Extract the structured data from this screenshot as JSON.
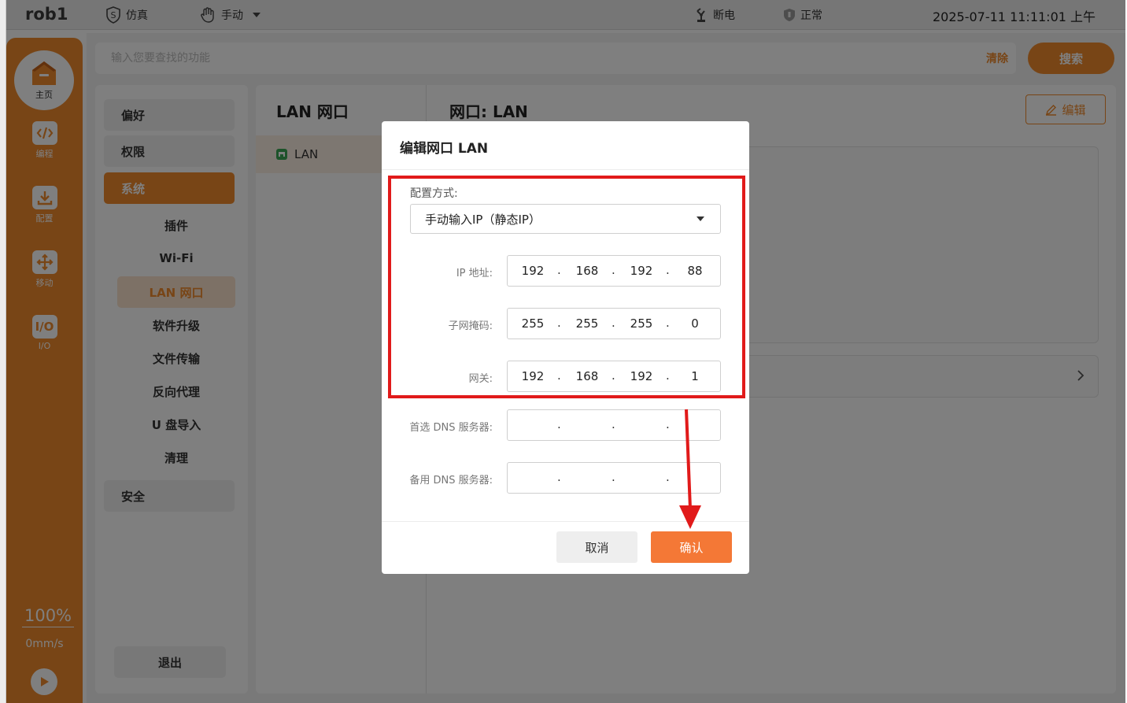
{
  "topbar": {
    "title": "rob1",
    "sim_label": "仿真",
    "manual_label": "手动",
    "power_label": "断电",
    "status_label": "正常",
    "datetime": "2025-07-11 11:11:01 上午"
  },
  "sidebar": {
    "home_label": "主页",
    "items": [
      {
        "label": "编程",
        "icon": "code-icon"
      },
      {
        "label": "配置",
        "icon": "download-icon"
      },
      {
        "label": "移动",
        "icon": "move-icon"
      },
      {
        "label": "I/O",
        "icon": "io-icon",
        "icon_text": "I/O"
      }
    ],
    "speed_percent": "100%",
    "speed_value": "0mm/s",
    "bottom_text": [
      "?",
      "?",
      "?",
      "?"
    ]
  },
  "search": {
    "placeholder": "输入您要查找的功能",
    "clear_label": "清除",
    "search_label": "搜索"
  },
  "settings_nav": {
    "categories": [
      "偏好",
      "权限",
      "系统",
      "安全"
    ],
    "active_category": "系统",
    "sub_items": [
      "插件",
      "Wi-Fi",
      "LAN 网口",
      "软件升级",
      "文件传输",
      "反向代理",
      "U 盘导入",
      "清理"
    ],
    "active_sub_item": "LAN 网口",
    "logout_label": "退出"
  },
  "iface_panel": {
    "title": "LAN 网口",
    "item_label": "LAN"
  },
  "detail_panel": {
    "title": "网口:  LAN",
    "edit_label": "编辑"
  },
  "modal": {
    "title": "编辑网口 LAN",
    "mode_label": "配置方式:",
    "mode_value": "手动输入IP（静态IP）",
    "fields": [
      {
        "label": "IP 地址:",
        "octets": [
          "192",
          "168",
          "192",
          "88"
        ]
      },
      {
        "label": "子网掩码:",
        "octets": [
          "255",
          "255",
          "255",
          "0"
        ]
      },
      {
        "label": "网关:",
        "octets": [
          "192",
          "168",
          "192",
          "1"
        ]
      },
      {
        "label": "首选 DNS 服务器:",
        "octets": [
          "",
          "",
          "",
          ""
        ]
      },
      {
        "label": "备用 DNS 服务器:",
        "octets": [
          "",
          "",
          "",
          ""
        ]
      }
    ],
    "cancel_label": "取消",
    "confirm_label": "确认"
  },
  "colors": {
    "accent": "#f08a2c",
    "confirm": "#f47836",
    "annotation": "#e11a1a"
  }
}
